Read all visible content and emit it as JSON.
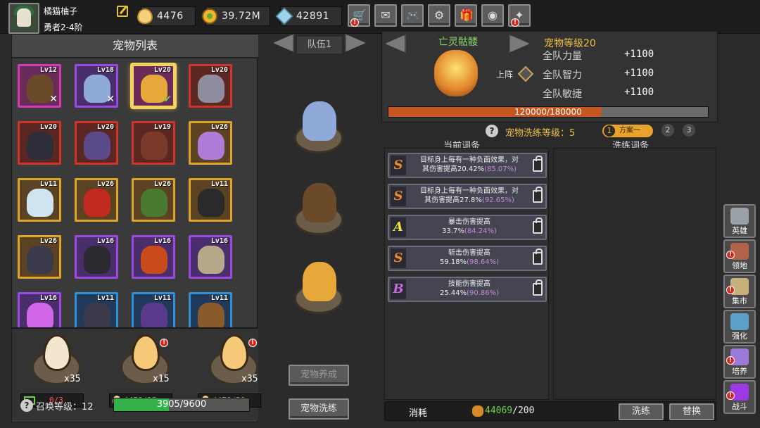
{
  "player": {
    "name": "橘猫柚子",
    "rank": "勇者2-4阶"
  },
  "resources": {
    "eggs": "4476",
    "coins": "39.72M",
    "gems": "42891"
  },
  "top_buttons": [
    {
      "icon": "shop-cart-icon",
      "alert": true
    },
    {
      "icon": "mail-icon",
      "alert": false
    },
    {
      "icon": "gamepad-icon",
      "alert": false
    },
    {
      "icon": "gear-icon",
      "alert": false
    },
    {
      "icon": "gift-icon",
      "alert": false
    },
    {
      "icon": "color-wheel-icon",
      "alert": false
    },
    {
      "icon": "sparkle-icon",
      "alert": true
    }
  ],
  "pet_list": {
    "title": "宠物列表",
    "cards": [
      {
        "lv": "Lv12",
        "rarity": "pink",
        "color": "#6b4a2a",
        "mark": "✕"
      },
      {
        "lv": "Lv18",
        "rarity": "purple",
        "color": "#8fa9d8",
        "mark": "✕"
      },
      {
        "lv": "Lv20",
        "rarity": "pink",
        "color": "#e7a83a",
        "mark": "✔",
        "selected": true
      },
      {
        "lv": "Lv20",
        "rarity": "red",
        "color": "#8d8d9d",
        "mark": ""
      },
      {
        "lv": "Lv20",
        "rarity": "red",
        "color": "#2e2e3a",
        "mark": ""
      },
      {
        "lv": "Lv20",
        "rarity": "red",
        "color": "#5a4a8a",
        "mark": ""
      },
      {
        "lv": "Lv19",
        "rarity": "red",
        "color": "#7a3a2a",
        "mark": ""
      },
      {
        "lv": "Lv26",
        "rarity": "gold",
        "color": "#b07ad8",
        "mark": ""
      },
      {
        "lv": "Lv11",
        "rarity": "gold",
        "color": "#cfe4f0",
        "mark": ""
      },
      {
        "lv": "Lv26",
        "rarity": "gold",
        "color": "#c22a20",
        "mark": ""
      },
      {
        "lv": "Lv26",
        "rarity": "gold",
        "color": "#4a7a30",
        "mark": ""
      },
      {
        "lv": "Lv11",
        "rarity": "gold",
        "color": "#2a2a2a",
        "mark": ""
      },
      {
        "lv": "Lv26",
        "rarity": "gold",
        "color": "#3a3a4a",
        "mark": ""
      },
      {
        "lv": "Lv16",
        "rarity": "purple",
        "color": "#2a2a30",
        "mark": ""
      },
      {
        "lv": "Lv16",
        "rarity": "purple",
        "color": "#c94a1a",
        "mark": ""
      },
      {
        "lv": "Lv16",
        "rarity": "purple",
        "color": "#b8a88a",
        "mark": ""
      },
      {
        "lv": "Lv16",
        "rarity": "purple",
        "color": "#d066e8",
        "mark": ""
      },
      {
        "lv": "Lv11",
        "rarity": "blue",
        "color": "#3a3a4a",
        "mark": ""
      },
      {
        "lv": "Lv11",
        "rarity": "blue",
        "color": "#5a3a8a",
        "mark": ""
      },
      {
        "lv": "Lv11",
        "rarity": "blue",
        "color": "#8a5a2a",
        "mark": ""
      }
    ]
  },
  "hatch": {
    "slots": [
      {
        "count": "x35",
        "egg_color": "#f2e6cf",
        "cost": "0/3",
        "cost_color": "#ff5252",
        "cost_icon": "video-icon",
        "alert": false
      },
      {
        "count": "x15",
        "egg_color": "#f5c978",
        "cost": "4476/15",
        "cost_color": "#6ed34a",
        "cost_icon": "egg-icon",
        "alert": true
      },
      {
        "count": "x35",
        "egg_color": "#f5c978",
        "cost": "4476/30",
        "cost_color": "#6ed34a",
        "cost_icon": "egg-icon",
        "alert": true
      }
    ],
    "summon_label": "召唤等级：12",
    "summon_text": "3905/9600",
    "summon_progress": 0.4068
  },
  "team": {
    "label": "队伍1",
    "slots": [
      {
        "color": "#8fa9d8"
      },
      {
        "color": "#6b4a2a"
      },
      {
        "color": "#e7a83a"
      }
    ],
    "cultivate_button": "宠物养成",
    "wash_button": "宠物洗练"
  },
  "pet_detail": {
    "name": "亡灵骷髅",
    "level_label": "宠物等级20",
    "deploy_label": "上阵",
    "stats": [
      {
        "label": "全队力量",
        "value": "+1100"
      },
      {
        "label": "全队智力",
        "value": "+1100"
      },
      {
        "label": "全队敏捷",
        "value": "+1100"
      }
    ],
    "exp_text": "120000/180000",
    "exp_progress": 0.6667
  },
  "wash": {
    "level_label": "宠物洗练等级：5",
    "plan_active": "1",
    "plan_active_label": "方案一",
    "plans": [
      "2",
      "3"
    ],
    "current_title": "当前词条",
    "wash_title": "洗练词条",
    "current": [
      {
        "grade": "S",
        "grade_color": "#f08a2a",
        "line1": "目标身上每有一种负面效果，对",
        "line2": "其伤害提高20.42%",
        "pct": "(85.07%)"
      },
      {
        "grade": "S",
        "grade_color": "#f08a2a",
        "line1": "目标身上每有一种负面效果，对",
        "line2": "其伤害提高27.8%",
        "pct": "(92.65%)"
      },
      {
        "grade": "A",
        "grade_color": "#f0e04a",
        "line1": "暴击伤害提高",
        "line2": "33.7%",
        "pct": "(84.24%)"
      },
      {
        "grade": "S",
        "grade_color": "#f08a2a",
        "line1": "斩击伤害提高",
        "line2": "59.18%",
        "pct": "(98.64%)"
      },
      {
        "grade": "B",
        "grade_color": "#c66ad8",
        "line1": "技能伤害提高",
        "line2": "25.44%",
        "pct": "(90.86%)"
      }
    ],
    "consume_label": "消耗",
    "consume_have": "44069",
    "consume_need": "/200",
    "wash_button": "洗练",
    "replace_button": "替换"
  },
  "sidebar": [
    {
      "label": "英雄",
      "icon": "helmet-icon",
      "color": "#9aa0a8",
      "alert": false
    },
    {
      "label": "领地",
      "icon": "castle-icon",
      "color": "#b0624a",
      "alert": true
    },
    {
      "label": "集市",
      "icon": "market-icon",
      "color": "#c8b07a",
      "alert": true
    },
    {
      "label": "强化",
      "icon": "anvil-icon",
      "color": "#5aa0c8",
      "alert": false
    },
    {
      "label": "培养",
      "icon": "potion-icon",
      "color": "#9a7ad8",
      "alert": true
    },
    {
      "label": "战斗",
      "icon": "portal-icon",
      "color": "#9a3ae0",
      "alert": true
    }
  ]
}
